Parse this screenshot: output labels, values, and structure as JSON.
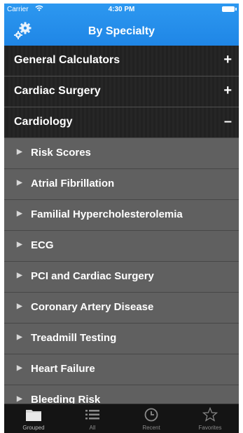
{
  "status_bar": {
    "carrier": "Carrier",
    "wifi_icon": "wifi-icon",
    "time": "4:30 PM",
    "battery_icon": "battery-icon"
  },
  "nav": {
    "title": "By Specialty",
    "left_icon": "gears-icon"
  },
  "categories": [
    {
      "label": "General Calculators",
      "toggle": "+"
    },
    {
      "label": "Cardiac Surgery",
      "toggle": "+"
    },
    {
      "label": "Cardiology",
      "toggle": "–"
    }
  ],
  "subcategories": [
    "Risk Scores",
    "Atrial Fibrillation",
    "Familial Hypercholesterolemia",
    "ECG",
    "PCI and Cardiac Surgery",
    "Coronary Artery Disease",
    "Treadmill Testing",
    "Heart Failure",
    "Bleeding Risk"
  ],
  "tabs": [
    {
      "label": "Grouped",
      "icon": "folder-icon",
      "active": true
    },
    {
      "label": "All",
      "icon": "list-icon",
      "active": false
    },
    {
      "label": "Recent",
      "icon": "clock-icon",
      "active": false
    },
    {
      "label": "Favorites",
      "icon": "star-icon",
      "active": false
    }
  ],
  "colors": {
    "accent": "#1f86e6",
    "category_bg": "#222222",
    "subcategory_bg": "#606060",
    "tabbar_bg": "#141414"
  }
}
